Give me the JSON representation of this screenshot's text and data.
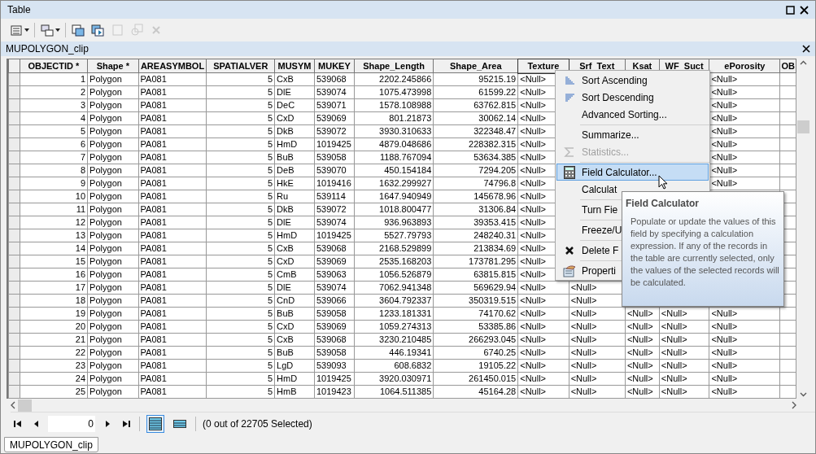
{
  "window": {
    "title": "Table"
  },
  "toolbar": [
    {
      "disabled": false
    },
    {
      "disabled": false
    },
    {
      "disabled": false
    },
    {
      "disabled": false
    },
    {
      "disabled": true
    },
    {
      "disabled": true
    },
    {
      "disabled": true
    }
  ],
  "table": {
    "title": "MUPOLYGON_clip",
    "columns": [
      {
        "label": "OBJECTID *",
        "numeric": true,
        "selected": false
      },
      {
        "label": "Shape *",
        "numeric": false,
        "selected": false
      },
      {
        "label": "AREASYMBOL",
        "numeric": false,
        "selected": false
      },
      {
        "label": "SPATIALVER",
        "numeric": true,
        "selected": false
      },
      {
        "label": "MUSYM",
        "numeric": false,
        "selected": false
      },
      {
        "label": "MUKEY",
        "numeric": false,
        "selected": false
      },
      {
        "label": "Shape_Length",
        "numeric": true,
        "selected": false
      },
      {
        "label": "Shape_Area",
        "numeric": true,
        "selected": false
      },
      {
        "label": "Texture",
        "numeric": false,
        "selected": true
      },
      {
        "label": "Srf_Text",
        "numeric": false,
        "selected": false
      },
      {
        "label": "Ksat",
        "numeric": false,
        "selected": false
      },
      {
        "label": "WF_Suct",
        "numeric": false,
        "selected": false
      },
      {
        "label": "ePorosity",
        "numeric": false,
        "selected": false
      },
      {
        "label": "OB",
        "selected": false
      }
    ],
    "rows": [
      [
        "1",
        "Polygon",
        "PA081",
        "5",
        "CxB",
        "539068",
        "2202.245866",
        "95215.19",
        "<Null>",
        null,
        null,
        null,
        "<Null>",
        null
      ],
      [
        "2",
        "Polygon",
        "PA081",
        "5",
        "DlE",
        "539074",
        "1075.473998",
        "61599.22",
        "<Null>",
        null,
        null,
        null,
        "<Null>",
        null
      ],
      [
        "3",
        "Polygon",
        "PA081",
        "5",
        "DeC",
        "539071",
        "1578.108988",
        "63762.815",
        "<Null>",
        null,
        null,
        null,
        "<Null>",
        null
      ],
      [
        "4",
        "Polygon",
        "PA081",
        "5",
        "CxD",
        "539069",
        "801.21873",
        "30062.14",
        "<Null>",
        null,
        null,
        null,
        "<Null>",
        null
      ],
      [
        "5",
        "Polygon",
        "PA081",
        "5",
        "DkB",
        "539072",
        "3930.310633",
        "322348.47",
        "<Null>",
        null,
        null,
        null,
        "<Null>",
        null
      ],
      [
        "6",
        "Polygon",
        "PA081",
        "5",
        "HmD",
        "1019425",
        "4879.048686",
        "228382.315",
        "<Null>",
        null,
        null,
        null,
        "<Null>",
        null
      ],
      [
        "7",
        "Polygon",
        "PA081",
        "5",
        "BuB",
        "539058",
        "1188.767094",
        "53634.385",
        "<Null>",
        null,
        null,
        null,
        "<Null>",
        null
      ],
      [
        "8",
        "Polygon",
        "PA081",
        "5",
        "DeB",
        "539070",
        "450.154184",
        "7294.205",
        "<Null>",
        null,
        null,
        null,
        "<Null>",
        null
      ],
      [
        "9",
        "Polygon",
        "PA081",
        "5",
        "HkE",
        "1019416",
        "1632.299927",
        "74796.8",
        "<Null>",
        null,
        null,
        null,
        "<Null>",
        null
      ],
      [
        "10",
        "Polygon",
        "PA081",
        "5",
        "Ru",
        "539114",
        "1647.940949",
        "145678.96",
        "<Null>",
        null,
        null,
        null,
        null,
        null
      ],
      [
        "11",
        "Polygon",
        "PA081",
        "5",
        "DkB",
        "539072",
        "1018.800477",
        "31306.84",
        "<Null>",
        null,
        null,
        null,
        null,
        null
      ],
      [
        "12",
        "Polygon",
        "PA081",
        "5",
        "DlE",
        "539074",
        "936.963893",
        "39353.415",
        "<Null>",
        null,
        null,
        null,
        null,
        null
      ],
      [
        "13",
        "Polygon",
        "PA081",
        "5",
        "HmD",
        "1019425",
        "5527.79793",
        "248240.31",
        "<Null>",
        null,
        null,
        null,
        null,
        null
      ],
      [
        "14",
        "Polygon",
        "PA081",
        "5",
        "CxB",
        "539068",
        "2168.529899",
        "213834.69",
        "<Null>",
        null,
        null,
        null,
        null,
        null
      ],
      [
        "15",
        "Polygon",
        "PA081",
        "5",
        "CxD",
        "539069",
        "2535.168203",
        "173781.295",
        "<Null>",
        null,
        null,
        null,
        null,
        null
      ],
      [
        "16",
        "Polygon",
        "PA081",
        "5",
        "CmB",
        "539063",
        "1056.526879",
        "63815.815",
        "<Null>",
        null,
        null,
        null,
        null,
        null
      ],
      [
        "17",
        "Polygon",
        "PA081",
        "5",
        "DlE",
        "539074",
        "7062.941348",
        "569629.94",
        "<Null>",
        "<Null>",
        null,
        null,
        null,
        null
      ],
      [
        "18",
        "Polygon",
        "PA081",
        "5",
        "CnD",
        "539066",
        "3604.792337",
        "350319.515",
        "<Null>",
        "<Null>",
        null,
        null,
        null,
        null
      ],
      [
        "19",
        "Polygon",
        "PA081",
        "5",
        "BuB",
        "539058",
        "1233.181331",
        "74170.62",
        "<Null>",
        "<Null>",
        "<Null>",
        "<Null>",
        "<Null>",
        null
      ],
      [
        "20",
        "Polygon",
        "PA081",
        "5",
        "CxD",
        "539069",
        "1059.274313",
        "53385.86",
        "<Null>",
        "<Null>",
        "<Null>",
        "<Null>",
        "<Null>",
        null
      ],
      [
        "21",
        "Polygon",
        "PA081",
        "5",
        "CxB",
        "539068",
        "3230.210485",
        "266293.045",
        "<Null>",
        "<Null>",
        "<Null>",
        "<Null>",
        "<Null>",
        null
      ],
      [
        "22",
        "Polygon",
        "PA081",
        "5",
        "BuB",
        "539058",
        "446.19341",
        "6740.25",
        "<Null>",
        "<Null>",
        "<Null>",
        "<Null>",
        "<Null>",
        null
      ],
      [
        "23",
        "Polygon",
        "PA081",
        "5",
        "LgD",
        "539093",
        "608.6832",
        "19105.22",
        "<Null>",
        "<Null>",
        "<Null>",
        "<Null>",
        "<Null>",
        null
      ],
      [
        "24",
        "Polygon",
        "PA081",
        "5",
        "HmD",
        "1019425",
        "3920.030971",
        "261450.015",
        "<Null>",
        "<Null>",
        "<Null>",
        "<Null>",
        "<Null>",
        null
      ],
      [
        "25",
        "Polygon",
        "PA081",
        "5",
        "HmB",
        "1019423",
        "1064.511385",
        "45164.28",
        "<Null>",
        "<Null>",
        "<Null>",
        "<Null>",
        "<Null>",
        null
      ]
    ]
  },
  "context_menu": [
    {
      "kind": "item",
      "label": "Sort Ascending",
      "disabled": false,
      "highlighted": false
    },
    {
      "kind": "item",
      "label": "Sort Descending",
      "disabled": false,
      "highlighted": false
    },
    {
      "kind": "item",
      "label": "Advanced Sorting...",
      "disabled": false,
      "highlighted": false
    },
    {
      "kind": "separator"
    },
    {
      "kind": "item",
      "label": "Summarize...",
      "disabled": false,
      "highlighted": false
    },
    {
      "kind": "item",
      "label": "Statistics...",
      "disabled": true,
      "highlighted": false
    },
    {
      "kind": "separator"
    },
    {
      "kind": "item",
      "label": "Field Calculator...",
      "disabled": false,
      "highlighted": true
    },
    {
      "kind": "item",
      "label": "Calculat",
      "disabled": false,
      "highlighted": false
    },
    {
      "kind": "separator"
    },
    {
      "kind": "item",
      "label": "Turn Fie",
      "disabled": false,
      "highlighted": false
    },
    {
      "kind": "separator"
    },
    {
      "kind": "item",
      "label": "Freeze/U",
      "disabled": false,
      "highlighted": false
    },
    {
      "kind": "separator"
    },
    {
      "kind": "item",
      "label": "Delete F",
      "disabled": false,
      "highlighted": false
    },
    {
      "kind": "separator"
    },
    {
      "kind": "item",
      "label": "Properti",
      "disabled": false,
      "highlighted": false
    }
  ],
  "tooltip": {
    "title": "Field Calculator",
    "text": "Populate or update the values of this field by specifying a calculation expression. If any of the records in the table are currently selected, only the values of the selected records will be calculated."
  },
  "navigator": {
    "record": "0",
    "views": [
      {
        "selected": true
      },
      {
        "selected": false
      }
    ],
    "status": "(0 out of 22705 Selected)"
  },
  "tabs": [
    {
      "label": "MUPOLYGON_clip",
      "selected": true
    }
  ]
}
